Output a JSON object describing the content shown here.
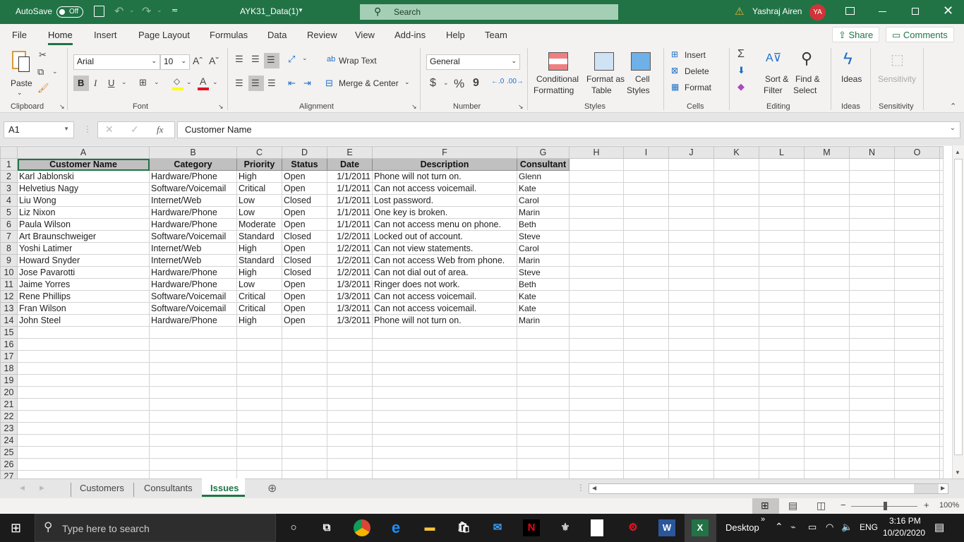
{
  "titlebar": {
    "autosave_label": "AutoSave",
    "autosave_state": "Off",
    "doc_title": "AYK31_Data(1)",
    "search_placeholder": "Search",
    "user_name": "Yashraj Airen",
    "user_initials": "YA",
    "accent": "#217346"
  },
  "menu": {
    "tabs": [
      "File",
      "Home",
      "Insert",
      "Page Layout",
      "Formulas",
      "Data",
      "Review",
      "View",
      "Add-ins",
      "Help",
      "Team"
    ],
    "active": "Home",
    "share": "Share",
    "comments": "Comments"
  },
  "ribbon": {
    "clipboard": {
      "paste": "Paste",
      "label": "Clipboard"
    },
    "font": {
      "name": "Arial",
      "size": "10",
      "label": "Font",
      "bold": "B",
      "italic": "I",
      "underline": "U"
    },
    "alignment": {
      "wrap_text": "Wrap Text",
      "merge_center": "Merge & Center",
      "label": "Alignment"
    },
    "number": {
      "format": "General",
      "label": "Number",
      "currency": "$",
      "percent": "%",
      "comma": "9"
    },
    "styles": {
      "conditional_1": "Conditional",
      "conditional_2": "Formatting",
      "format_table_1": "Format as",
      "format_table_2": "Table",
      "cell_styles_1": "Cell",
      "cell_styles_2": "Styles",
      "label": "Styles"
    },
    "cells": {
      "insert": "Insert",
      "delete": "Delete",
      "format": "Format",
      "label": "Cells"
    },
    "editing": {
      "sort_1": "Sort &",
      "sort_2": "Filter",
      "find_1": "Find &",
      "find_2": "Select",
      "label": "Editing"
    },
    "ideas": {
      "button": "Ideas",
      "label": "Ideas"
    },
    "sensitivity": {
      "button": "Sensitivity",
      "label": "Sensitivity"
    }
  },
  "formula_bar": {
    "name_box": "A1",
    "fx": "fx",
    "value": "Customer Name"
  },
  "sheet": {
    "columns": [
      "A",
      "B",
      "C",
      "D",
      "E",
      "F",
      "G",
      "H",
      "I",
      "J",
      "K",
      "L",
      "M",
      "N",
      "O"
    ],
    "header_row": [
      "Customer Name",
      "Category",
      "Priority",
      "Status",
      "Date",
      "Description",
      "Consultant"
    ],
    "rows": [
      [
        "Karl Jablonski",
        "Hardware/Phone",
        "High",
        "Open",
        "1/1/2011",
        "Phone will not turn on.",
        "Glenn"
      ],
      [
        "Helvetius Nagy",
        "Software/Voicemail",
        "Critical",
        "Open",
        "1/1/2011",
        "Can not access voicemail.",
        "Kate"
      ],
      [
        "Liu Wong",
        "Internet/Web",
        "Low",
        "Closed",
        "1/1/2011",
        "Lost password.",
        "Carol"
      ],
      [
        "Liz Nixon",
        "Hardware/Phone",
        "Low",
        "Open",
        "1/1/2011",
        "One key is broken.",
        "Marin"
      ],
      [
        "Paula Wilson",
        "Hardware/Phone",
        "Moderate",
        "Open",
        "1/1/2011",
        "Can not access menu on phone.",
        "Beth"
      ],
      [
        "Art Braunschweiger",
        "Software/Voicemail",
        "Standard",
        "Closed",
        "1/2/2011",
        "Locked out of account.",
        "Steve"
      ],
      [
        "Yoshi Latimer",
        "Internet/Web",
        "High",
        "Open",
        "1/2/2011",
        "Can not view statements.",
        "Carol"
      ],
      [
        "Howard Snyder",
        "Internet/Web",
        "Standard",
        "Closed",
        "1/2/2011",
        "Can not access Web from phone.",
        "Marin"
      ],
      [
        "Jose Pavarotti",
        "Hardware/Phone",
        "High",
        "Closed",
        "1/2/2011",
        "Can not dial out of area.",
        "Steve"
      ],
      [
        "Jaime Yorres",
        "Hardware/Phone",
        "Low",
        "Open",
        "1/3/2011",
        "Ringer does not work.",
        "Beth"
      ],
      [
        "Rene Phillips",
        "Software/Voicemail",
        "Critical",
        "Open",
        "1/3/2011",
        "Can not access voicemail.",
        "Kate"
      ],
      [
        "Fran Wilson",
        "Software/Voicemail",
        "Critical",
        "Open",
        "1/3/2011",
        "Can not access voicemail.",
        "Kate"
      ],
      [
        "John Steel",
        "Hardware/Phone",
        "High",
        "Open",
        "1/3/2011",
        "Phone will not turn on.",
        "Marin"
      ]
    ],
    "row_count_visible": 27,
    "active_cell": "A1"
  },
  "sheet_tabs": {
    "tabs": [
      "Customers",
      "Consultants",
      "Issues"
    ],
    "active": "Issues"
  },
  "statusbar": {
    "zoom": "100%",
    "zoom_minus": "−",
    "zoom_plus": "+"
  },
  "taskbar": {
    "search_placeholder": "Type here to search",
    "desktop_label": "Desktop",
    "language": "ENG",
    "time": "3:16 PM",
    "date": "10/20/2020"
  }
}
